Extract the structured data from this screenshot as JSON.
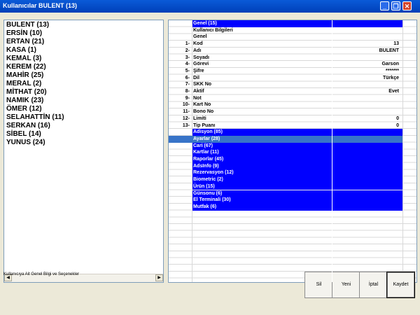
{
  "window": {
    "title": "Kullanıcılar BULENT  (13)"
  },
  "users": [
    "BULENT  (13)",
    "ERSİN  (10)",
    "ERTAN  (21)",
    "KASA  (1)",
    "KEMAL  (3)",
    "KEREM  (22)",
    "MAHİR  (25)",
    "MERAL  (2)",
    "MİTHAT  (20)",
    "NAMIK  (23)",
    "ÖMER  (12)",
    "SELAHATTİN  (11)",
    "SERKAN  (16)",
    "SİBEL  (14)",
    "YUNUS  (24)"
  ],
  "grid": {
    "rows": [
      {
        "num": "",
        "label": "Genel (15)",
        "value": "",
        "type": "cat"
      },
      {
        "num": "",
        "label": "Kullanıcı Bilgileri",
        "value": "",
        "type": "plain"
      },
      {
        "num": "",
        "label": "Genel",
        "value": "",
        "type": "plain"
      },
      {
        "num": "1-",
        "label": "Kod",
        "value": "13",
        "type": "field"
      },
      {
        "num": "2-",
        "label": "Adı",
        "value": "BULENT",
        "type": "field"
      },
      {
        "num": "3-",
        "label": "Soyadı",
        "value": "",
        "type": "field"
      },
      {
        "num": "4-",
        "label": "Görevi",
        "value": "Garson",
        "type": "field"
      },
      {
        "num": "5-",
        "label": "Şifre",
        "value": "*******",
        "type": "field"
      },
      {
        "num": "6-",
        "label": "Dil",
        "value": "Türkçe",
        "type": "field"
      },
      {
        "num": "7-",
        "label": "SKK No",
        "value": "",
        "type": "field"
      },
      {
        "num": "8-",
        "label": "Aktif",
        "value": "Evet",
        "type": "field"
      },
      {
        "num": "9-",
        "label": "Not",
        "value": "",
        "type": "field"
      },
      {
        "num": "10-",
        "label": "Kart No",
        "value": "",
        "type": "field"
      },
      {
        "num": "11-",
        "label": "Bono No",
        "value": "",
        "type": "field"
      },
      {
        "num": "12-",
        "label": "Limiti",
        "value": "0",
        "type": "field"
      },
      {
        "num": "13-",
        "label": "Tip Puanı",
        "value": "0",
        "type": "field"
      },
      {
        "num": "",
        "label": "Adisyon (85)",
        "value": "",
        "type": "cat"
      },
      {
        "num": "",
        "label": "Ayarlar (28)",
        "value": "",
        "type": "sel"
      },
      {
        "num": "",
        "label": "Cari (67)",
        "value": "",
        "type": "cat"
      },
      {
        "num": "",
        "label": "Kartlar (11)",
        "value": "",
        "type": "cat"
      },
      {
        "num": "",
        "label": "Raporlar (45)",
        "value": "",
        "type": "cat"
      },
      {
        "num": "",
        "label": "AdsInfo (9)",
        "value": "",
        "type": "cat"
      },
      {
        "num": "",
        "label": "Rezervasyon (12)",
        "value": "",
        "type": "cat"
      },
      {
        "num": "",
        "label": "Biometric (2)",
        "value": "",
        "type": "cat"
      },
      {
        "num": "",
        "label": "Ürün (15)",
        "value": "",
        "type": "cat"
      },
      {
        "num": "",
        "label": "Günsonu (6)",
        "value": "",
        "type": "cat"
      },
      {
        "num": "",
        "label": "El Terminali (30)",
        "value": "",
        "type": "cat"
      },
      {
        "num": "",
        "label": "Mutfak (6)",
        "value": "",
        "type": "cat"
      }
    ]
  },
  "status": "Kullanıcıya Ait Genel Bilgi ve Seçenekler",
  "buttons": {
    "delete": "Sil",
    "new": "Yeni",
    "cancel": "İptal",
    "save": "Kaydet"
  }
}
